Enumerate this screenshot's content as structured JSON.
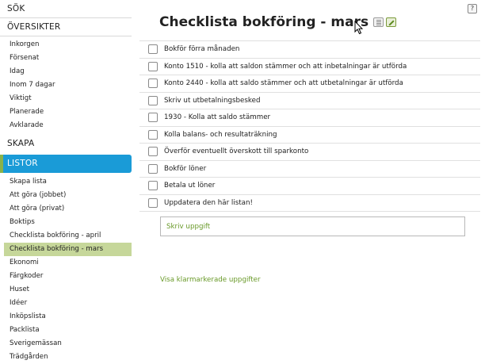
{
  "sidebar": {
    "search_label": "SÖK",
    "overviews": {
      "heading": "ÖVERSIKTER",
      "items": [
        "Inkorgen",
        "Försenat",
        "Idag",
        "Inom 7 dagar",
        "Viktigt",
        "Planerade",
        "Avklarade"
      ]
    },
    "create_label": "SKAPA",
    "lists": {
      "heading": "LISTOR",
      "items": [
        "Skapa lista",
        "Att göra (jobbet)",
        "Att göra (privat)",
        "Boktips",
        "Checklista bokföring - april",
        "Checklista bokföring - mars",
        "Ekonomi",
        "Färgkoder",
        "Huset",
        "Idéer",
        "Inköpslista",
        "Packlista",
        "Sverigemässan",
        "Trädgården"
      ],
      "active_item": "Checklista bokföring - mars"
    }
  },
  "main": {
    "title": "Checklista bokföring - mars",
    "help_label": "?",
    "tasks": [
      "Bokför förra månaden",
      "Konto 1510 - kolla att saldon stämmer och att inbetalningar är utförda",
      "Konto 2440 - kolla att saldo stämmer och att utbetalningar är utförda",
      "Skriv ut utbetalningsbesked",
      "1930 - Kolla att saldo stämmer",
      "Kolla balans- och resultaträkning",
      "Överför eventuellt överskott till sparkonto",
      "Bokför löner",
      "Betala ut löner",
      "Uppdatera den här listan!"
    ],
    "new_task_placeholder": "Skriv uppgift",
    "show_completed_label": "Visa klarmarkerade uppgifter"
  },
  "colors": {
    "listor_header": "#1a9bd7",
    "active_list": "#c6d79a",
    "link_green": "#6a9a2a"
  }
}
